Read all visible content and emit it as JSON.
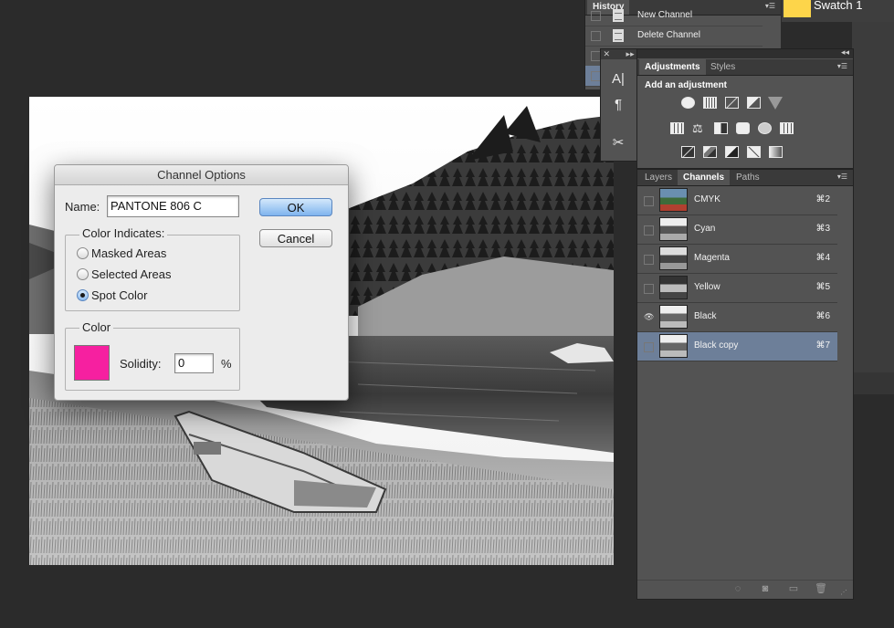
{
  "history": {
    "tab_label": "History",
    "rows": [
      {
        "label": "New Channel"
      },
      {
        "label": "Delete Channel"
      }
    ]
  },
  "swatches": {
    "label": "Swatch 1",
    "color": "#fdd54a"
  },
  "toolstrip": {
    "tools": [
      "character-icon",
      "paragraph-icon",
      "tool-presets-icon"
    ]
  },
  "adjustments": {
    "tabs": [
      "Adjustments",
      "Styles"
    ],
    "active_tab": "Adjustments",
    "heading": "Add an adjustment",
    "icons": [
      "brightness-contrast-icon",
      "levels-icon",
      "curves-icon",
      "exposure-icon",
      "vibrance-icon",
      "hue-saturation-icon",
      "color-balance-icon",
      "black-white-icon",
      "photo-filter-icon",
      "channel-mixer-icon",
      "color-lookup-icon",
      "invert-icon",
      "posterize-icon",
      "threshold-icon",
      "selective-color-icon",
      "gradient-map-icon"
    ]
  },
  "channels_panel": {
    "tabs": [
      "Layers",
      "Channels",
      "Paths"
    ],
    "active_tab": "Channels",
    "rows": [
      {
        "name": "CMYK",
        "shortcut": "⌘2",
        "visible": false,
        "selected": false,
        "thumb": "color"
      },
      {
        "name": "Cyan",
        "shortcut": "⌘3",
        "visible": false,
        "selected": false,
        "thumb": "gray"
      },
      {
        "name": "Magenta",
        "shortcut": "⌘4",
        "visible": false,
        "selected": false,
        "thumb": "gray"
      },
      {
        "name": "Yellow",
        "shortcut": "⌘5",
        "visible": false,
        "selected": false,
        "thumb": "dark"
      },
      {
        "name": "Black",
        "shortcut": "⌘6",
        "visible": true,
        "selected": false,
        "thumb": "gray"
      },
      {
        "name": "Black copy",
        "shortcut": "⌘7",
        "visible": false,
        "selected": true,
        "thumb": "gray"
      }
    ],
    "bottom_icons": [
      "load-selection-icon",
      "save-selection-icon",
      "new-channel-icon",
      "delete-channel-icon"
    ],
    "selected_color": "#6d7f99"
  },
  "dialog": {
    "title": "Channel Options",
    "name_label": "Name:",
    "name_value": "PANTONE 806 C",
    "ok_label": "OK",
    "cancel_label": "Cancel",
    "color_indicates_label": "Color Indicates:",
    "options": [
      {
        "label": "Masked Areas",
        "selected": false
      },
      {
        "label": "Selected Areas",
        "selected": false
      },
      {
        "label": "Spot Color",
        "selected": true
      }
    ],
    "color_group_label": "Color",
    "spot_color": "#f620a0",
    "solidity_label": "Solidity:",
    "solidity_value": "0",
    "percent_label": "%"
  }
}
